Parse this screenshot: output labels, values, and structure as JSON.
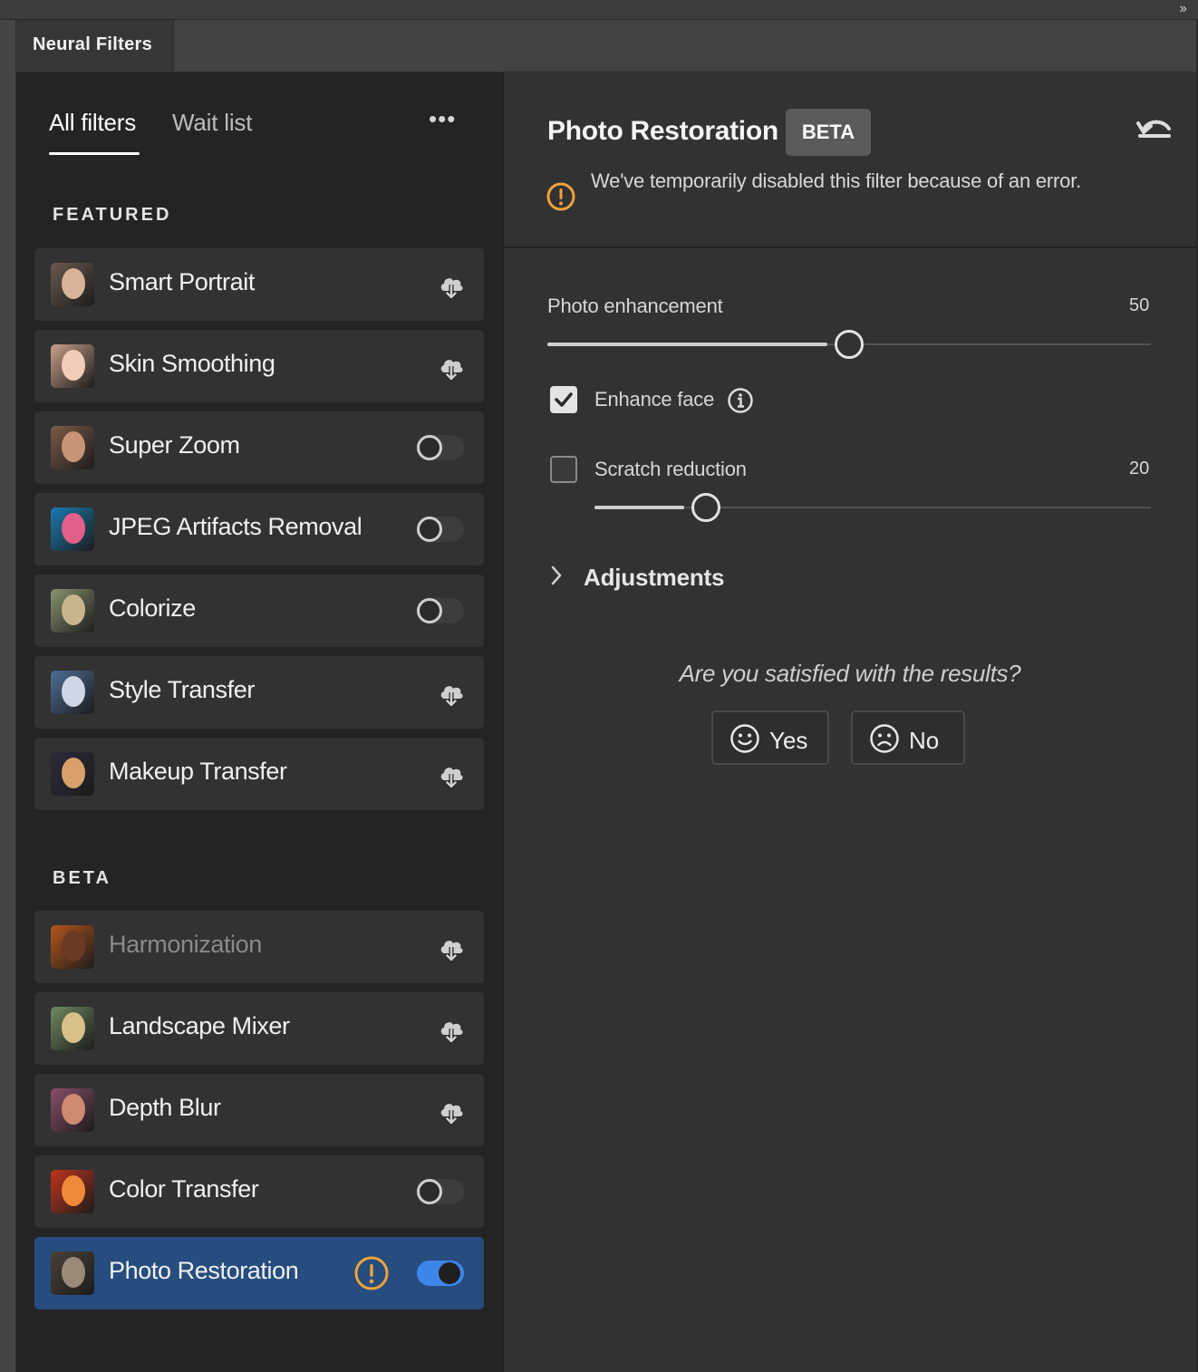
{
  "app": {
    "panel_title": "Neural Filters",
    "collapse_glyph": "››"
  },
  "nav": {
    "tabs": [
      {
        "label": "All filters",
        "active": true
      },
      {
        "label": "Wait list",
        "active": false
      }
    ],
    "more_glyph": "•••"
  },
  "sections": {
    "featured": "FEATURED",
    "beta": "BETA"
  },
  "filters": [
    {
      "name": "Smart Portrait",
      "control": "cloud-download-icon"
    },
    {
      "name": "Skin Smoothing",
      "control": "cloud-download-icon"
    },
    {
      "name": "Super Zoom",
      "control": "toggle-off"
    },
    {
      "name": "JPEG Artifacts Removal",
      "control": "toggle-off"
    },
    {
      "name": "Colorize",
      "control": "toggle-off"
    },
    {
      "name": "Style Transfer",
      "control": "cloud-download-icon"
    },
    {
      "name": "Makeup Transfer",
      "control": "cloud-download-icon"
    },
    {
      "name": "Harmonization",
      "control": "cloud-download-icon",
      "disabled": true
    },
    {
      "name": "Landscape Mixer",
      "control": "cloud-download-icon"
    },
    {
      "name": "Depth Blur",
      "control": "cloud-download-icon"
    },
    {
      "name": "Color Transfer",
      "control": "toggle-off"
    },
    {
      "name": "Photo Restoration",
      "control": "toggle-on",
      "selected": true,
      "status": "alert-icon"
    }
  ],
  "detail": {
    "title": "Photo Restoration",
    "badge": "BETA",
    "warning": "We've temporarily disabled this filter because of an error.",
    "photo_enhancement": {
      "label": "Photo enhancement",
      "value": "50",
      "level": 50
    },
    "enhance_face": {
      "label": "Enhance face",
      "checked": true
    },
    "scratch_reduction": {
      "label": "Scratch reduction",
      "value": "20",
      "level": 20,
      "checked": false
    },
    "adjustments": "Adjustments",
    "feedback": {
      "question": "Are you satisfied with the results?",
      "yes": "Yes",
      "no": "No"
    }
  },
  "colors": {
    "accent": "#3d86e9",
    "selected_row": "#264d7e",
    "warning": "#f0a23a",
    "panel_dark": "#242424",
    "panel": "#323232"
  }
}
